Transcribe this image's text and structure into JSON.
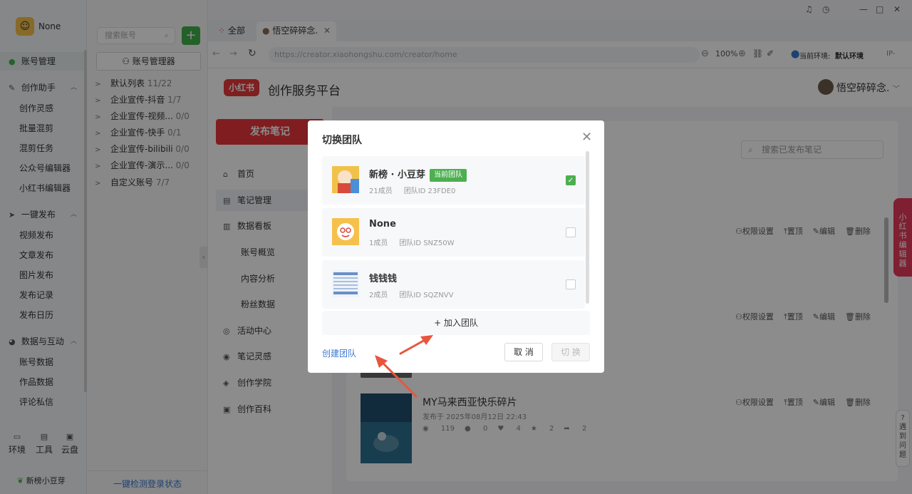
{
  "app": {
    "username": "None",
    "brand": "新榜小豆芽"
  },
  "leftnav": {
    "account_mgmt": "账号管理",
    "creation_assistant": "创作助手",
    "creation_items": [
      "创作灵感",
      "批量混剪",
      "混剪任务",
      "公众号编辑器",
      "小红书编辑器"
    ],
    "one_click_publish": "一键发布",
    "publish_items": [
      "视频发布",
      "文章发布",
      "图片发布",
      "发布记录",
      "发布日历"
    ],
    "data_interaction": "数据与互动",
    "data_items": [
      "账号数据",
      "作品数据",
      "评论私信"
    ],
    "tools": [
      "环境",
      "工具",
      "云盘"
    ]
  },
  "acct_panel": {
    "search_placeholder": "搜索账号",
    "manager_label": "账号管理器",
    "groups": [
      {
        "name": "默认列表",
        "count": "11/22"
      },
      {
        "name": "企业宣传-抖音",
        "count": "1/7"
      },
      {
        "name": "企业宣传-视频...",
        "count": "0/0"
      },
      {
        "name": "企业宣传-快手",
        "count": "0/1"
      },
      {
        "name": "企业宣传-bilibili",
        "count": "0/0"
      },
      {
        "name": "企业宣传-演示...",
        "count": "0/0"
      },
      {
        "name": "自定义账号",
        "count": "7/7"
      }
    ],
    "check_status": "一键检测登录状态"
  },
  "tabs": {
    "all": "全部",
    "active": "悟空碎碎念."
  },
  "address": {
    "url": "https://creator.xiaohongshu.com/creator/home",
    "zoom": "100%",
    "env_label": "当前环境:",
    "env_value": "默认环境",
    "ip": "IP-"
  },
  "page": {
    "logo": "小红书",
    "platform": "创作服务平台",
    "user": "悟空碎碎念.",
    "publish_button": "发布笔记",
    "menu": [
      "首页",
      "笔记管理",
      "数据看板",
      "账号概览",
      "内容分析",
      "粉丝数据",
      "活动中心",
      "笔记灵感",
      "创作学院",
      "创作百科"
    ],
    "search_notes": "搜索已发布笔记",
    "row_actions": [
      "权限设置",
      "置顶",
      "编辑",
      "删除"
    ],
    "post": {
      "title": "MY马来西亚快乐碎片",
      "date": "发布于 2025年08月12日 22:43",
      "stats": [
        "119",
        "0",
        "4",
        "2",
        "2"
      ]
    },
    "side_tab": "小红书编辑器",
    "feedback": "遇到问题"
  },
  "modal": {
    "title": "切换团队",
    "teams": [
      {
        "name": "新榜 · 小豆芽",
        "current_badge": "当前团队",
        "members": "21成员",
        "team_id": "团队ID 23FDE0",
        "checked": true
      },
      {
        "name": "None",
        "members": "1成员",
        "team_id": "团队ID SNZ50W",
        "checked": false
      },
      {
        "name": "钱钱钱",
        "members": "2成员",
        "team_id": "团队ID SQZNVV",
        "checked": false
      }
    ],
    "join_team": "+ 加入团队",
    "create_team": "创建团队",
    "cancel": "取 消",
    "switch": "切 换"
  },
  "colors": {
    "accent_red": "#e8353d",
    "green": "#4caf50",
    "link": "#3a77d0",
    "annotation_arrow": "#e8553d"
  }
}
